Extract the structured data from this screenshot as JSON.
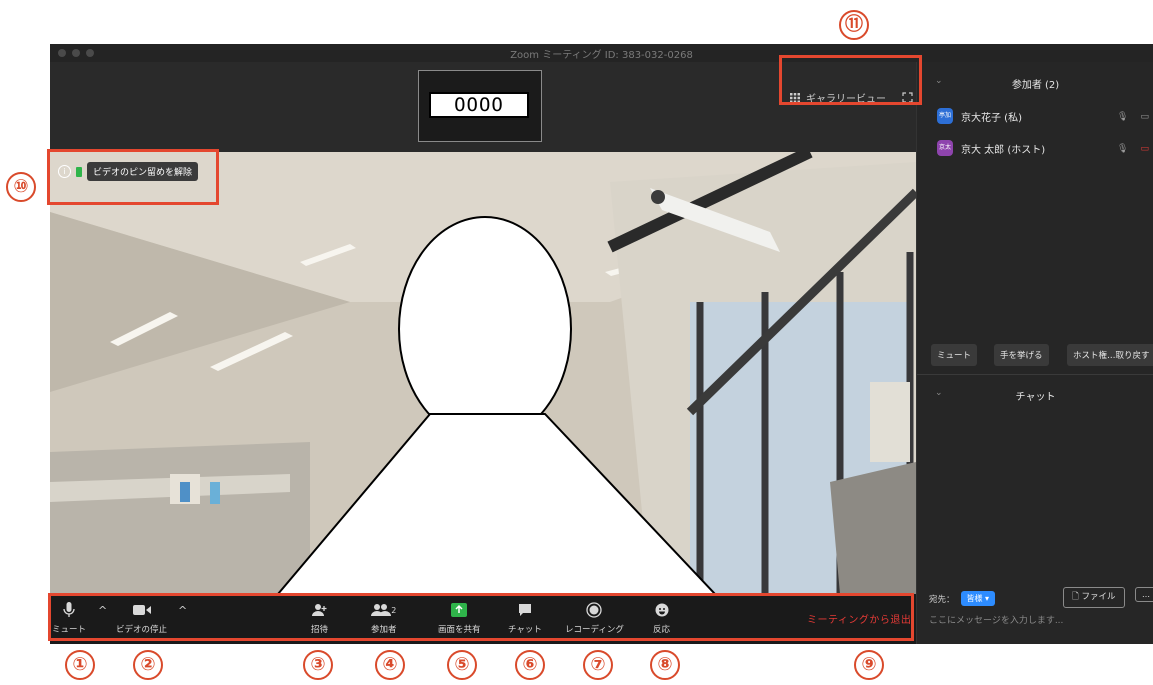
{
  "window": {
    "title": "Zoom ミーティング ID: 383-032-0268"
  },
  "thumbnail": {
    "name": "OOOO"
  },
  "view": {
    "gallery_label": "ギャラリービュー"
  },
  "video": {
    "unpin_label": "ビデオのピン留めを解除"
  },
  "toolbar": {
    "mute": "ミュート",
    "stop_video": "ビデオの停止",
    "invite": "招待",
    "participants": "参加者",
    "participants_count": "2",
    "share": "画面を共有",
    "chat": "チャット",
    "record": "レコーディング",
    "reactions": "反応",
    "leave": "ミーティングから退出"
  },
  "participants_panel": {
    "header": "参加者 (2)",
    "members": [
      {
        "avatar": "亭加",
        "name": "京大花子 (私)",
        "avatar_color": "#2d6fd6"
      },
      {
        "avatar": "京太",
        "name": "京大 太郎 (ホスト)",
        "avatar_color": "#8e44ad"
      }
    ],
    "buttons": {
      "mute": "ミュート",
      "raise_hand": "手を挙げる",
      "reclaim_host": "ホスト権…取り戻す"
    }
  },
  "chat_panel": {
    "header": "チャット",
    "to_label": "宛先：",
    "to_value": "皆様",
    "file_button": "ファイル",
    "more_button": "…",
    "placeholder": "ここにメッセージを入力します..."
  },
  "callouts": [
    "①",
    "②",
    "③",
    "④",
    "⑤",
    "⑥",
    "⑦",
    "⑧",
    "⑨",
    "⑩",
    "⑪"
  ],
  "colors": {
    "accent": "#2d8cff",
    "leave": "#e53a36",
    "annotation": "#e4472f",
    "share_green": "#2fb44a"
  }
}
